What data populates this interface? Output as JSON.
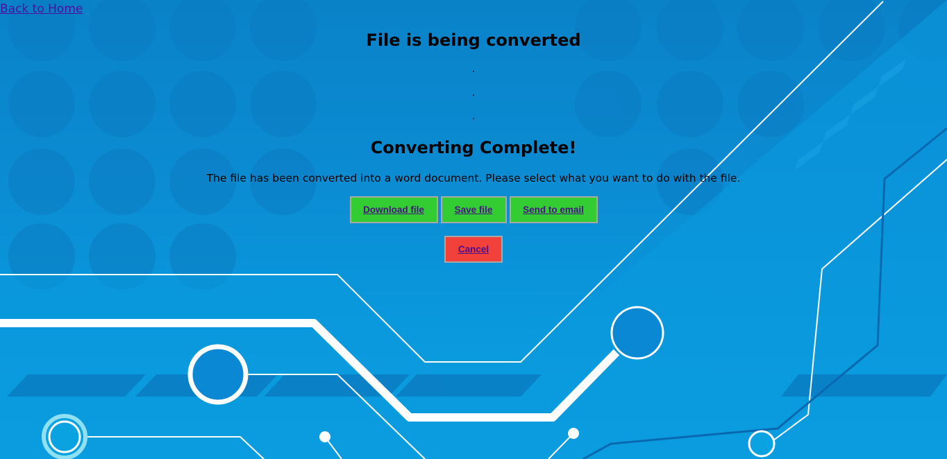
{
  "nav": {
    "back_link": "Back to Home"
  },
  "status": {
    "converting_title": "File is being converted",
    "dots": [
      ".",
      ".",
      "."
    ],
    "complete_title": "Converting Complete!",
    "message": "The file has been converted into a word document. Please select what you want to do with the file."
  },
  "actions": {
    "download": "Download file",
    "save": "Save file",
    "email": "Send to email",
    "cancel": "Cancel"
  },
  "colors": {
    "background": "#0a8cd3",
    "action_button": "#33cc33",
    "cancel_button": "#f2403a",
    "link": "#4b0fa0"
  }
}
